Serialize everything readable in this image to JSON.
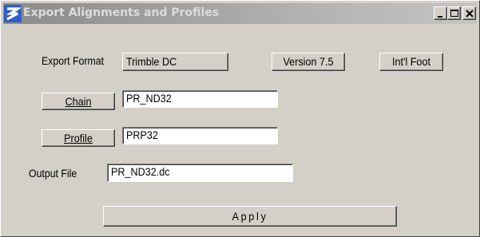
{
  "window": {
    "title": "Export Alignments and Profiles",
    "controls": [
      "minimize",
      "maximize",
      "close"
    ]
  },
  "export_format": {
    "label": "Export Format",
    "format_button": "Trimble DC",
    "version_button": "Version 7.5",
    "units_button": "Int'l Foot"
  },
  "chain": {
    "button": "Chain",
    "value": "PR_ND32"
  },
  "profile": {
    "button": "Profile",
    "value": "PRP32"
  },
  "output_file": {
    "label": "Output File",
    "value": "PR_ND32.dc"
  },
  "apply_button": "Apply",
  "icons": {
    "app": "app-logo-icon",
    "minimize": "minimize-icon",
    "maximize": "maximize-icon",
    "close": "close-icon"
  }
}
